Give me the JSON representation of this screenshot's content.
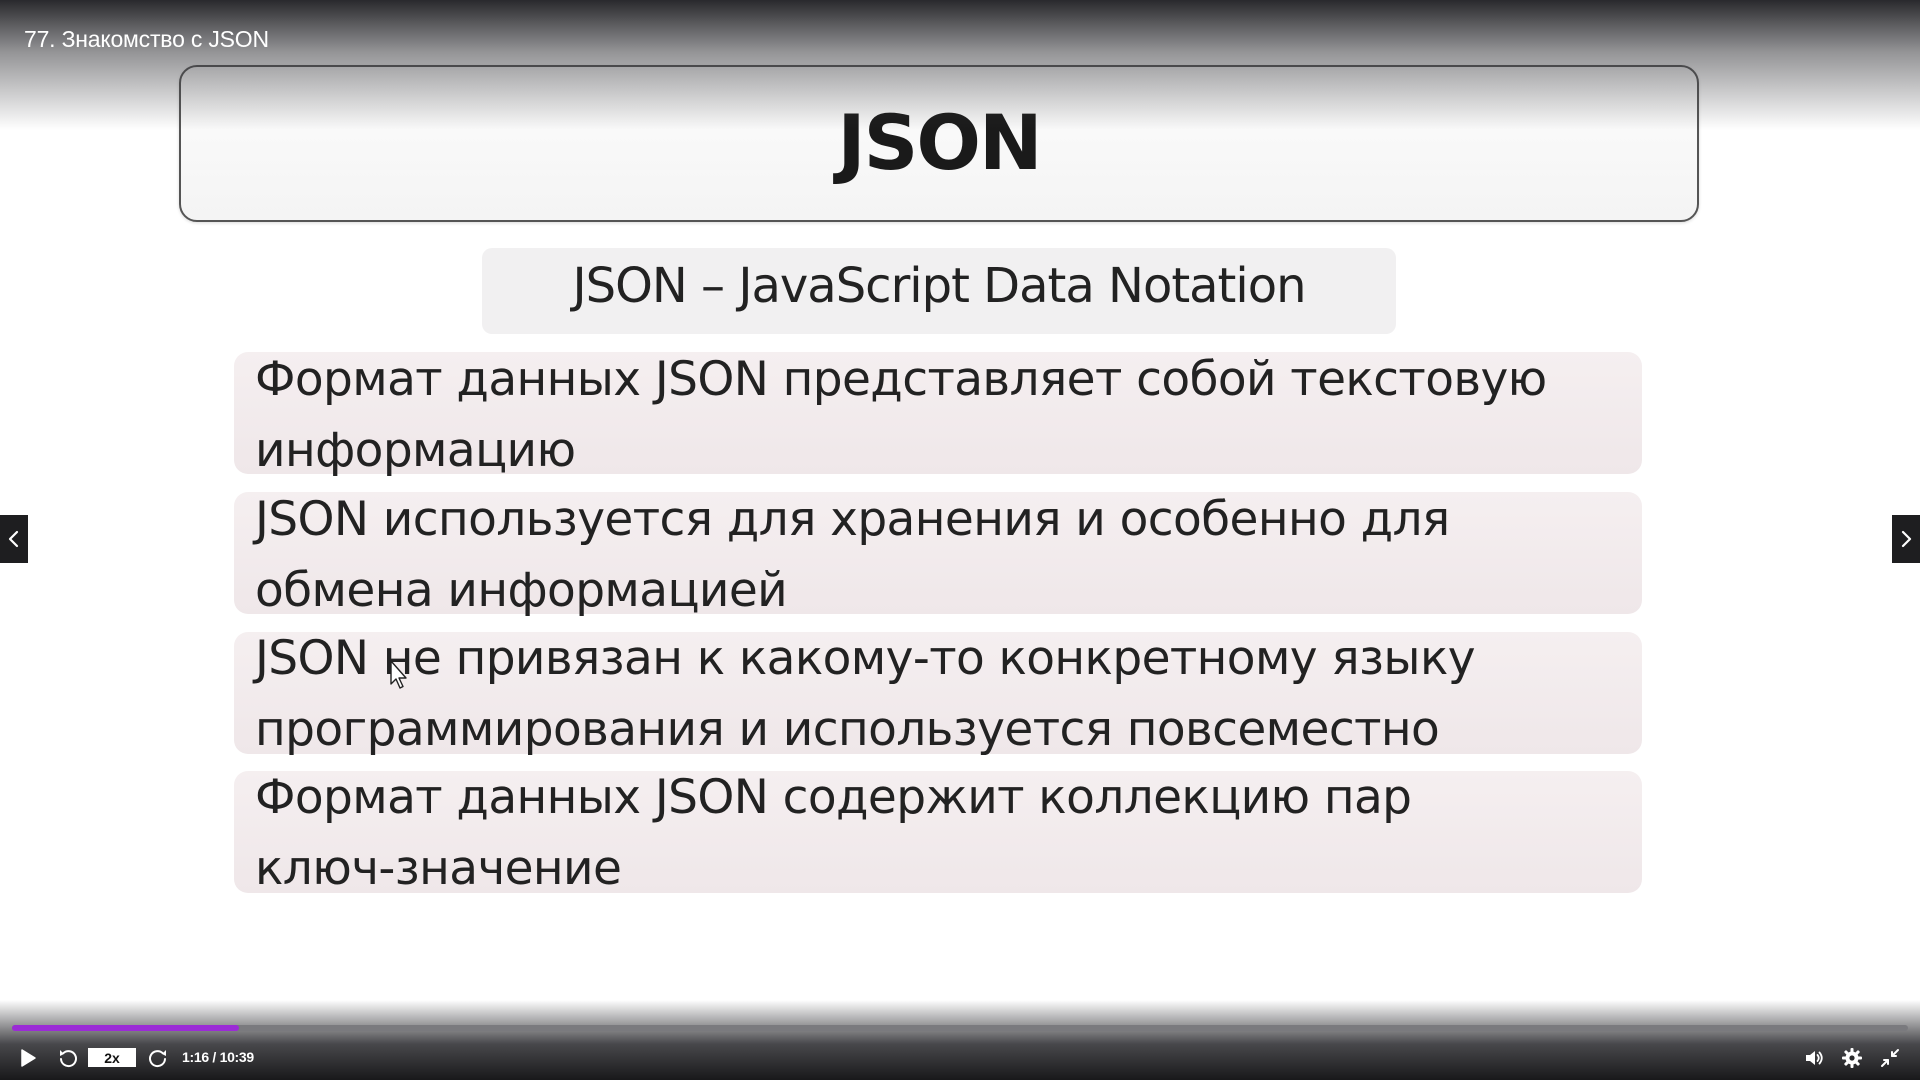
{
  "video": {
    "title": "77. Знакомство с JSON"
  },
  "slide": {
    "title": "JSON",
    "subtitle": "JSON – JavaScript Data Notation",
    "bullets": [
      {
        "line1": "Формат данных JSON представляет собой текстовую",
        "line2": "информацию"
      },
      {
        "line1": "JSON используется для хранения и особенно для",
        "line2": "обмена информацией"
      },
      {
        "line1": "JSON не привязан к какому-то конкретному языку",
        "line2": "программирования и используется повсеместно"
      },
      {
        "line1": "Формат данных JSON содержит коллекцию пар",
        "line2": "ключ-значение"
      }
    ]
  },
  "player": {
    "speed": "2x",
    "time": "1:16 / 10:39",
    "progress": 0.1195,
    "accent_color": "#9b2bd6",
    "icons": [
      "play-icon",
      "rewind-icon",
      "forward-icon",
      "volume-icon",
      "gear-icon",
      "exit-fullscreen-icon",
      "chevron-left-icon",
      "chevron-right-icon"
    ]
  }
}
